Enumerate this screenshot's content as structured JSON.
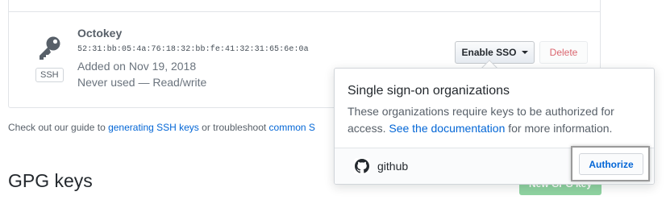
{
  "ssh_key": {
    "title": "Octokey",
    "fingerprint": "52:31:bb:05:4a:76:18:32:bb:fe:41:32:31:65:6e:0a",
    "added": "Added on Nov 19, 2018",
    "usage": "Never used — Read/write",
    "type_label": "SSH",
    "icon": "key-icon"
  },
  "buttons": {
    "enable_sso": "Enable SSO",
    "delete": "Delete",
    "new_gpg_key": "New GPG key"
  },
  "help": {
    "prefix": "Check out our guide to ",
    "link1": "generating SSH keys",
    "middle": " or troubleshoot ",
    "link2": "common S"
  },
  "gpg": {
    "heading": "GPG keys"
  },
  "popover": {
    "title": "Single sign-on organizations",
    "desc_prefix": "These organizations require keys to be authorized for access. ",
    "desc_link": "See the documentation",
    "desc_suffix": " for more information.",
    "org_name": "github",
    "org_icon": "github-octocat-icon",
    "authorize": "Authorize"
  },
  "colors": {
    "link": "#0366d6",
    "danger": "#cb2431",
    "success": "#8fd3a1",
    "border": "#e1e4e8"
  }
}
